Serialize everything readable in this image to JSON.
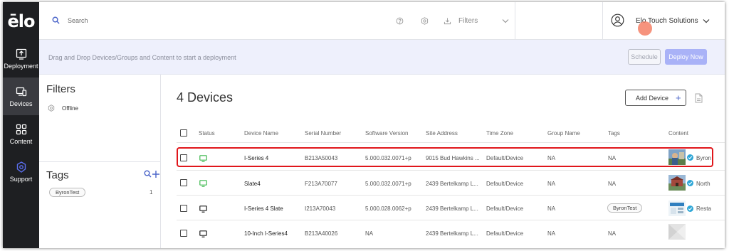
{
  "app": {
    "logo": "ēlo"
  },
  "nav": {
    "items": [
      {
        "label": "Deployment",
        "icon": "deployment-icon"
      },
      {
        "label": "Devices",
        "icon": "devices-icon"
      },
      {
        "label": "Content",
        "icon": "content-icon"
      },
      {
        "label": "Support",
        "icon": "support-icon"
      }
    ],
    "active": "Devices"
  },
  "header": {
    "search_placeholder": "Search",
    "filters_label": "Filters",
    "user_name": "Elo Touch Solutions"
  },
  "deploy_bar": {
    "hint": "Drag and Drop Devices/Groups and Content to start a deployment",
    "schedule_label": "Schedule",
    "deploy_label": "Deploy Now"
  },
  "sidebar": {
    "filters_title": "Filters",
    "filters": [
      {
        "label": "Offline"
      }
    ],
    "tags_title": "Tags",
    "tags": [
      {
        "label": "ByronTest",
        "count": "1"
      }
    ]
  },
  "main": {
    "title": "4 Devices",
    "add_device_label": "Add Device",
    "add_device_icon": "+",
    "columns": [
      "Status",
      "Device Name",
      "Serial Number",
      "Software Version",
      "Site Address",
      "Time Zone",
      "Group Name",
      "Tags",
      "Content"
    ],
    "rows": [
      {
        "status": "online",
        "name": "I-Series 4",
        "serial": "B213A50043",
        "version": "5.000.032.0071+p",
        "address": "9015 Bud Hawkins ...",
        "timezone": "Default/Device",
        "group": "NA",
        "tags": "NA",
        "content": "Byron",
        "highlighted": true
      },
      {
        "status": "online",
        "name": "Slate4",
        "serial": "F213A70077",
        "version": "5.000.032.0071+p",
        "address": "2439 Bertelkamp L...",
        "timezone": "Default/Device",
        "group": "NA",
        "tags": "NA",
        "content": "North",
        "highlighted": false
      },
      {
        "status": "offline",
        "name": "I-Series 4 Slate",
        "serial": "I213A70043",
        "version": "5.000.028.0062+p",
        "address": "2439 Bertelkamp L...",
        "timezone": "Default/Device",
        "group": "NA",
        "tags": "ByronTest",
        "content": "Resta",
        "highlighted": false
      },
      {
        "status": "offline",
        "name": "10-Inch I-Series4",
        "serial": "B213A40026",
        "version": "NA",
        "address": "2439 Bertelkamp L...",
        "timezone": "Default/Device",
        "group": "NA",
        "tags": "NA",
        "content": "",
        "highlighted": false
      }
    ]
  },
  "colors": {
    "nav_bg": "#1e1f22",
    "nav_active": "#3a3b40",
    "deploy_bar_bg": "#eef0fc",
    "deploy_button": "#a9b2f7",
    "status_online": "#3fb950",
    "status_offline": "#222222",
    "accent": "#4a64c9",
    "highlight_border": "#e0161b"
  }
}
